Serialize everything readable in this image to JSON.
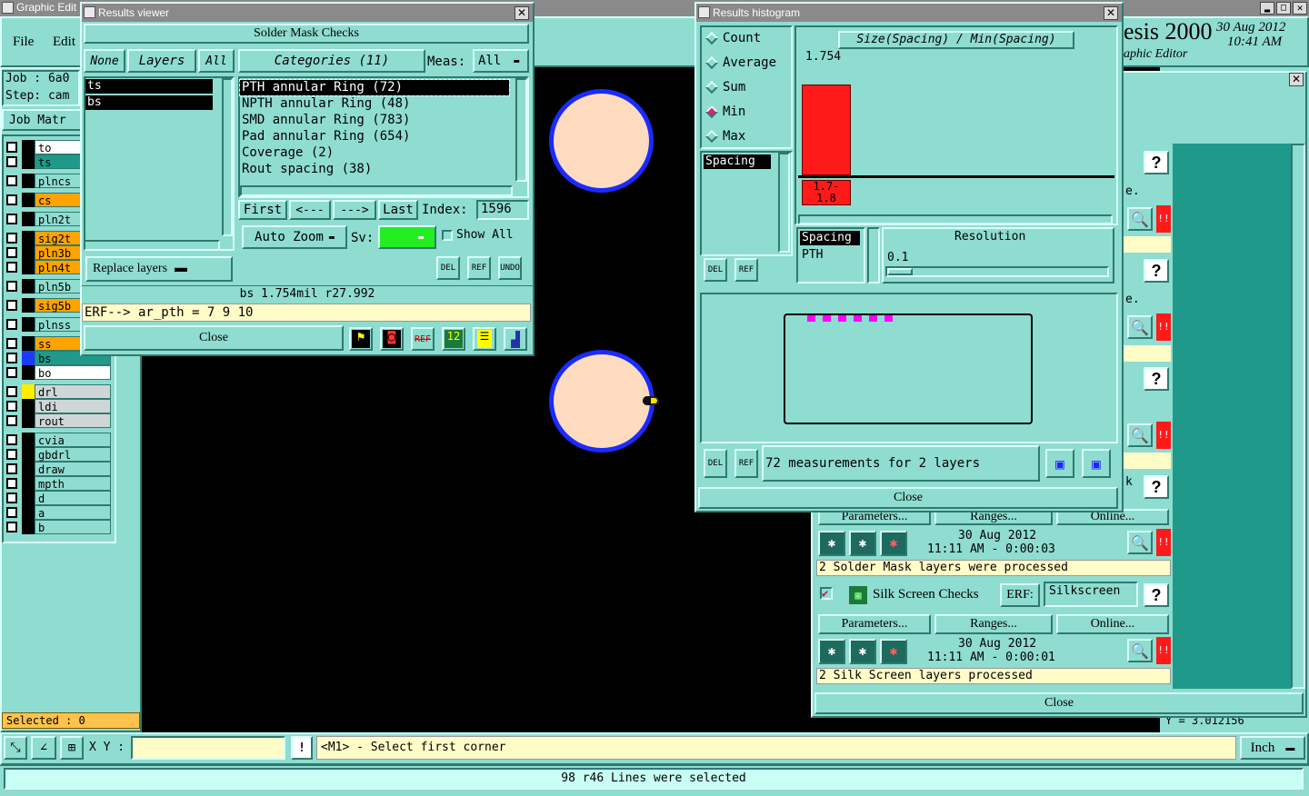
{
  "main": {
    "title": "Graphic Edit",
    "menu": [
      "File",
      "Edit"
    ],
    "job": "Job  : 6a0",
    "step": "Step: cam",
    "job_matrix": "Job Matr",
    "layers": [
      {
        "name": "to",
        "bg": "#ffffff",
        "box": "#000000"
      },
      {
        "name": "ts",
        "bg": "#1f9a8a",
        "box": "#000000"
      },
      {
        "name": "plncs",
        "bg": "#8fdcd0",
        "box": "#000000"
      },
      {
        "name": "cs",
        "bg": "#ffa300",
        "box": "#000000"
      },
      {
        "name": "pln2t",
        "bg": "#8fdcd0",
        "box": "#000000"
      },
      {
        "name": "sig2t",
        "bg": "#ffa300",
        "box": "#000000"
      },
      {
        "name": "pln3b",
        "bg": "#ffa300",
        "box": "#000000"
      },
      {
        "name": "pln4t",
        "bg": "#ffa300",
        "box": "#000000"
      },
      {
        "name": "pln5b",
        "bg": "#8fdcd0",
        "box": "#000000"
      },
      {
        "name": "sig5b",
        "bg": "#ffa300",
        "box": "#000000"
      },
      {
        "name": "plnss",
        "bg": "#8fdcd0",
        "box": "#000000"
      },
      {
        "name": "ss",
        "bg": "#ffa300",
        "box": "#000000"
      },
      {
        "name": "bs",
        "bg": "#1f9a8a",
        "box": "#1a3bff"
      },
      {
        "name": "bo",
        "bg": "#ffffff",
        "box": "#000000"
      },
      {
        "name": "drl",
        "bg": "#cfd6d6",
        "box": "#ffee00"
      },
      {
        "name": "ldi",
        "bg": "#cfd6d6",
        "box": "#000000"
      },
      {
        "name": "rout",
        "bg": "#cfd6d6",
        "box": "#000000"
      },
      {
        "name": "cvia",
        "bg": "#8fdcd0",
        "box": "#000000"
      },
      {
        "name": "gbdrl",
        "bg": "#8fdcd0",
        "box": "#000000"
      },
      {
        "name": "draw",
        "bg": "#8fdcd0",
        "box": "#000000"
      },
      {
        "name": "mpth",
        "bg": "#8fdcd0",
        "box": "#000000"
      },
      {
        "name": "d",
        "bg": "#8fdcd0",
        "box": "#000000"
      },
      {
        "name": "a",
        "bg": "#8fdcd0",
        "box": "#000000"
      },
      {
        "name": "b",
        "bg": "#8fdcd0",
        "box": "#000000"
      }
    ],
    "selected": "Selected : 0",
    "brand": "esis 2000",
    "brand_sub": "aphic Editor",
    "date": "30 Aug 2012",
    "time": "10:41 AM",
    "xy_label": "X Y :",
    "status_prompt": "<M1> - Select first corner",
    "unit": "Inch",
    "bottom_status": "98 r46 Lines were selected",
    "coord_readout": "Y = 3.012156"
  },
  "results_viewer": {
    "title": "Results viewer",
    "heading": "Solder Mask Checks",
    "none": "None",
    "layers_label": "Layers",
    "all": "All",
    "layer_list": [
      "ts",
      "bs"
    ],
    "replace_layers": "Replace layers",
    "categories_label": "Categories (11)",
    "meas_label": "Meas:",
    "meas_value": "All",
    "categories": [
      "PTH annular Ring (72)",
      "NPTH annular Ring (48)",
      "SMD annular Ring (783)",
      "Pad annular Ring (654)",
      "Coverage (2)",
      "Rout spacing (38)"
    ],
    "first": "First",
    "prev": "<---",
    "next": "--->",
    "last": "Last",
    "index_label": "Index:",
    "index_value": "1596",
    "auto_zoom": "Auto Zoom",
    "sv_label": "Sv:",
    "show_all": "Show All",
    "del": "DEL",
    "ref": "REF",
    "undo": "UNDO",
    "measure_text": "bs 1.754mil  r27.992",
    "erf_text": "ERF--> ar_pth = 7 9 10",
    "close": "Close"
  },
  "results_histogram": {
    "title": "Results histogram",
    "modes": [
      "Count",
      "Average",
      "Sum",
      "Min",
      "Max"
    ],
    "selected_mode": "Min",
    "measure_item": "Spacing",
    "chart_title": "Size(Spacing) / Min(Spacing)",
    "bar_value": "1.754",
    "bar_fraction": 0.82,
    "bin_label_1": "1.7-",
    "bin_label_2": "1.8",
    "list2": [
      "Spacing",
      "PTH"
    ],
    "resolution_label": "Resolution",
    "resolution_value": "0.1",
    "del": "DEL",
    "ref": "REF",
    "measurements_text": "72 measurements for 2 layers",
    "close": "Close"
  },
  "checklist": {
    "row1_sub": "e.",
    "row3_sub": "e.",
    "row5_label": "k",
    "params": "Parameters...",
    "ranges": "Ranges...",
    "online": "Online...",
    "date": "30 Aug 2012",
    "sm_time": "11:11 AM - 0:00:03",
    "sm_msg": "2 Solder Mask layers were processed",
    "silk_title": "Silk Screen Checks",
    "erf_label": "ERF:",
    "erf_value": "Silkscreen",
    "silk_time": "11:11 AM - 0:00:01",
    "silk_msg": "2 Silk Screen layers processed",
    "close": "Close",
    "help": "?",
    "alert": "!!"
  },
  "colors": {
    "teal": "#8fdcd0",
    "pad": "#ffdcc0",
    "pad_ring": "#1a2bff",
    "hist_bar": "#ff1a1a",
    "magenta": "#ff00ff"
  }
}
